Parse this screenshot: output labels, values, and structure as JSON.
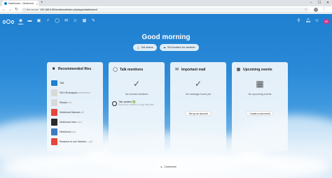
{
  "browser": {
    "tab_title": "Dashboard - Nextcloud",
    "tab_close": "×",
    "new_tab": "+",
    "not_secure": "ⓘ Not secure",
    "url": "192.168.0.60/nextcloud/index.php/apps/dashboard/",
    "win_min": "–",
    "win_max": "☐",
    "win_close": "✕"
  },
  "topnav": {
    "icons": [
      "dashboard-icon",
      "files-icon",
      "photos-icon",
      "activity-icon",
      "talk-icon",
      "mail-icon",
      "contacts-icon",
      "calendar-icon",
      "notes-icon"
    ],
    "avatar_initial": "M"
  },
  "greeting": "Good morning",
  "status_buttons": {
    "set_status": "Set status",
    "set_location": "Set location for weather"
  },
  "panels": {
    "recommended": {
      "title": "Recommended files",
      "files": [
        {
          "name": "Talk",
          "ext": "",
          "type": "folder"
        },
        {
          "name": "SW Off analysis",
          "ext": " shitlabeled",
          "type": "doc"
        },
        {
          "name": "Simple",
          "ext": ".md",
          "type": "doc"
        },
        {
          "name": "Nextcloud Manual",
          "ext": ".pdf",
          "type": "red"
        },
        {
          "name": "Nextcloud intro",
          "ext": ".mp4",
          "type": "video"
        },
        {
          "name": "Nextcloud",
          "ext": ".png",
          "type": "blue"
        },
        {
          "name": "Reasons to use Nextclo...",
          "ext": ".pdf",
          "type": "red"
        }
      ]
    },
    "talk": {
      "title": "Talk mentions",
      "empty_text": "No unread mentions",
      "mention_title": "Talk updates ✅",
      "mention_sub": "Since you moved to a pp talk with"
    },
    "mail": {
      "title": "Important mail",
      "empty_text": "No message found yet",
      "button": "Set up an account"
    },
    "events": {
      "title": "Upcoming events",
      "empty_text": "No upcoming events",
      "button": "Create a new event"
    }
  },
  "customize": "Customize"
}
